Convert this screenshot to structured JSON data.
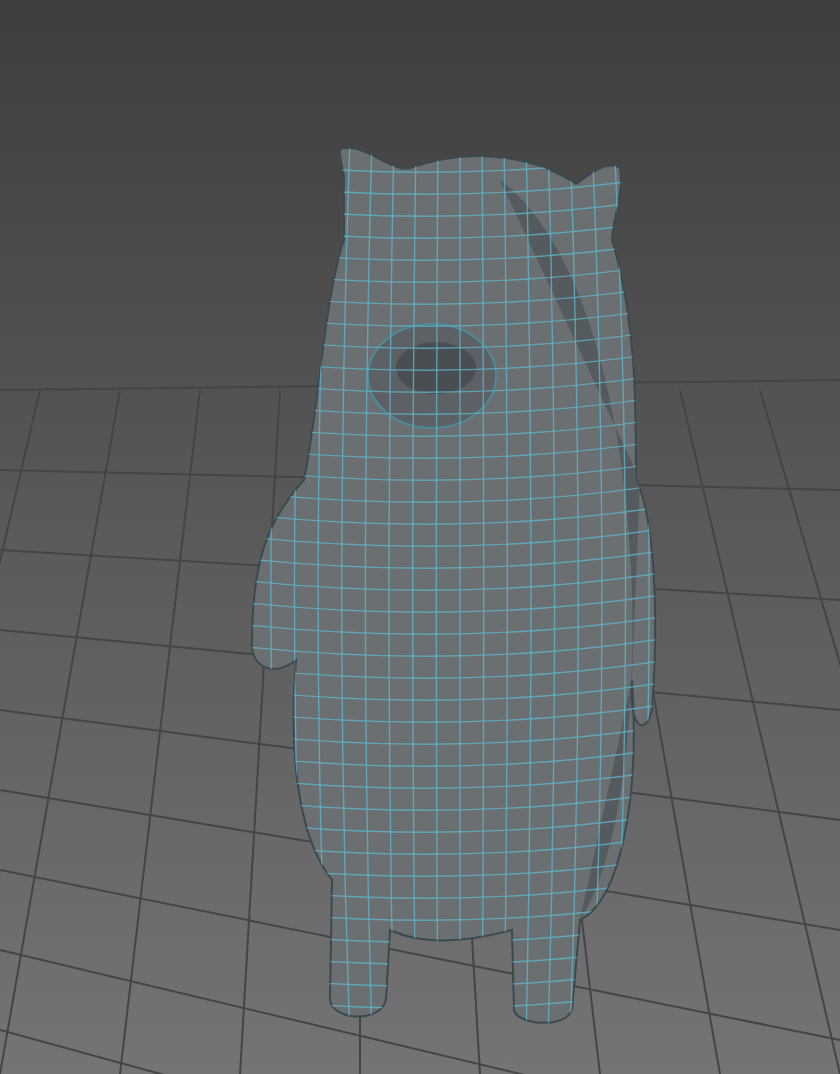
{
  "viewport": {
    "grid": true,
    "wireframe": true
  }
}
